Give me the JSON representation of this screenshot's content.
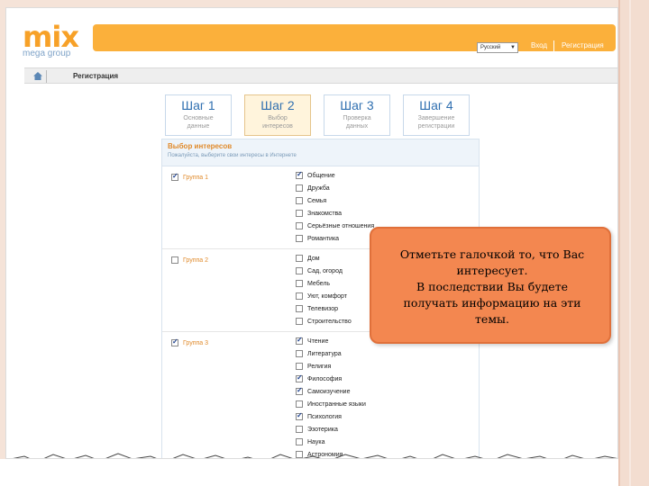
{
  "header": {
    "logo_main": "mix",
    "logo_sub": "mega group",
    "language": "Русский",
    "login": "Вход",
    "register": "Регистрация"
  },
  "breadcrumb": {
    "current": "Регистрация"
  },
  "steps": [
    {
      "number": "Шаг 1",
      "line1": "Основные",
      "line2": "данные",
      "active": false
    },
    {
      "number": "Шаг 2",
      "line1": "Выбор",
      "line2": "интересов",
      "active": true
    },
    {
      "number": "Шаг 3",
      "line1": "Проверка",
      "line2": "данных",
      "active": false
    },
    {
      "number": "Шаг 4",
      "line1": "Завершение",
      "line2": "регистрации",
      "active": false
    }
  ],
  "form": {
    "title": "Выбор интересов",
    "subtitle": "Пожалуйста, выберите свои интересы в Интернете",
    "groups": [
      {
        "label": "Группа 1",
        "checked": true,
        "items": [
          {
            "label": "Общение",
            "checked": true
          },
          {
            "label": "Дружба",
            "checked": false
          },
          {
            "label": "Семья",
            "checked": false
          },
          {
            "label": "Знакомства",
            "checked": false
          },
          {
            "label": "Серьёзные отношения",
            "checked": false
          },
          {
            "label": "Романтика",
            "checked": false
          }
        ]
      },
      {
        "label": "Группа 2",
        "checked": false,
        "items": [
          {
            "label": "Дом",
            "checked": false
          },
          {
            "label": "Сад, огород",
            "checked": false
          },
          {
            "label": "Мебель",
            "checked": false
          },
          {
            "label": "Уют, комфорт",
            "checked": false
          },
          {
            "label": "Телевизор",
            "checked": false
          },
          {
            "label": "Строительство",
            "checked": false
          }
        ]
      },
      {
        "label": "Группа 3",
        "checked": true,
        "items": [
          {
            "label": "Чтение",
            "checked": true
          },
          {
            "label": "Литература",
            "checked": false
          },
          {
            "label": "Религия",
            "checked": false
          },
          {
            "label": "Философия",
            "checked": true
          },
          {
            "label": "Самоизучение",
            "checked": true
          },
          {
            "label": "Иностранные языки",
            "checked": false
          },
          {
            "label": "Психология",
            "checked": true
          },
          {
            "label": "Эзотерика",
            "checked": false
          },
          {
            "label": "Наука",
            "checked": false
          },
          {
            "label": "Астрономия",
            "checked": false
          }
        ]
      }
    ]
  },
  "callout": {
    "line1": "Отметьте галочкой то, что Вас",
    "line2": "интересует.",
    "line3": "В последствии Вы будете",
    "line4": "получать информацию на эти",
    "line5": "темы."
  },
  "colors": {
    "accent_orange": "#fbb03b",
    "callout_fill": "#f38750",
    "link_blue": "#2f6fb0"
  }
}
